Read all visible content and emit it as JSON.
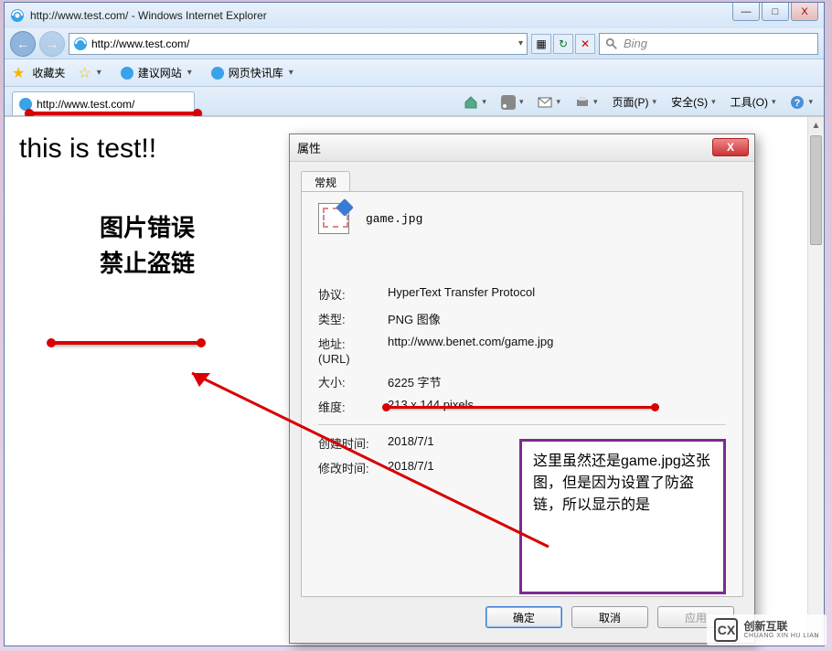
{
  "window": {
    "title": "http://www.test.com/ - Windows Internet Explorer",
    "minimize": "—",
    "maximize": "□",
    "close": "X"
  },
  "nav": {
    "back": "←",
    "forward": "→",
    "address": "http://www.test.com/",
    "refresh": "↻",
    "stop": "✕",
    "search_placeholder": "Bing"
  },
  "favbar": {
    "favorites": "收藏夹",
    "suggested": "建议网站",
    "webslice": "网页快讯库"
  },
  "tab": {
    "label": "http://www.test.com/"
  },
  "tabtools": {
    "page": "页面(P)",
    "safety": "安全(S)",
    "tools": "工具(O)"
  },
  "page": {
    "heading": "this is test!!",
    "img_line1": "图片错误",
    "img_line2": "禁止盗链"
  },
  "dialog": {
    "title": "属性",
    "tab_general": "常规",
    "filename": "game.jpg",
    "protocol_label": "协议:",
    "protocol_value": "HyperText Transfer Protocol",
    "type_label": "类型:",
    "type_value": "PNG 图像",
    "url_label": "地址:\n(URL)",
    "url_value": "http://www.benet.com/game.jpg",
    "size_label": "大小:",
    "size_value": "6225 字节",
    "dim_label": "维度:",
    "dim_value": "213 x 144 pixels",
    "created_label": "创建时间:",
    "created_value": "2018/7/1",
    "modified_label": "修改时间:",
    "modified_value": "2018/7/1",
    "ok": "确定",
    "cancel": "取消",
    "apply": "应用"
  },
  "annotation": {
    "text": "这里虽然还是game.jpg这张图，但是因为设置了防盗链，所以显示的是"
  },
  "watermark": {
    "cn": "创新互联",
    "en": "CHUANG XIN HU LIAN"
  }
}
